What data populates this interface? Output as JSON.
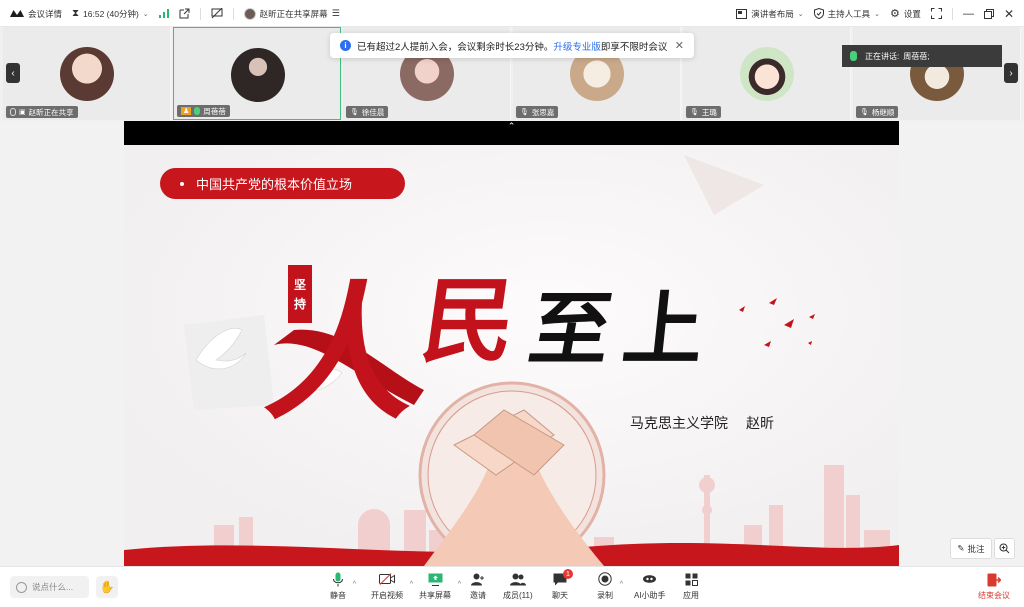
{
  "topbar": {
    "meeting_details": "会议详情",
    "time": "16:52 (40分钟)",
    "sharing_status": "赵昕正在共享屏幕",
    "presenter_layout": "演讲者布局",
    "host_tools": "主持人工具",
    "settings": "设置"
  },
  "participants": [
    {
      "name": "赵昕正在共享",
      "face": "#e9c7b6"
    },
    {
      "name": "周蓓蓓",
      "face": "#4a3f3d"
    },
    {
      "name": "徐佳晨",
      "face": "#d9b7b0"
    },
    {
      "name": "张思嘉",
      "face": "#e8d7c6"
    },
    {
      "name": "王璐",
      "face": "#f4d9c7"
    },
    {
      "name": "杨继顺",
      "face": "#b89a7c"
    }
  ],
  "notice": {
    "text_before": "已有超过2人提前入会，会议剩余时长23分钟。",
    "link": "升级专业版",
    "text_after": "即享不限时会议"
  },
  "speaking": {
    "label": "正在讲话:",
    "name": "周蓓蓓;"
  },
  "slide": {
    "collapse_arrow": "⌃",
    "pill": "中国共产党的根本价值立场",
    "seal_1": "坚",
    "seal_2": "持",
    "title_chars": [
      "人",
      "民",
      "至",
      "上"
    ],
    "college": "马克思主义学院",
    "presenter": "赵昕"
  },
  "slide_tools": {
    "annotate": "批注"
  },
  "bottombar": {
    "say_placeholder": "说点什么...",
    "mute": "静音",
    "video": "开启视频",
    "share": "共享屏幕",
    "invite": "邀请",
    "members": "成员(11)",
    "chat": "聊天",
    "chat_badge": "1",
    "record": "录制",
    "ai": "AI小助手",
    "apps": "应用",
    "end": "结束会议"
  },
  "colors": {
    "accent_red": "#c2121b",
    "active_border": "#3fbf7f",
    "link_blue": "#2a6ee6"
  }
}
